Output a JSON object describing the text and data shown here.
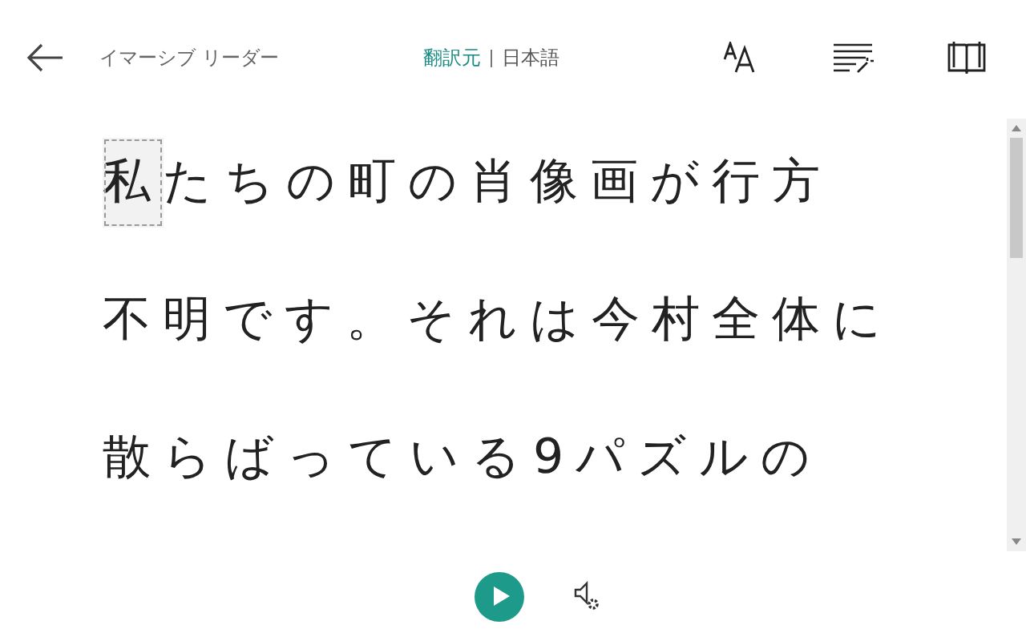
{
  "header": {
    "title": "イマーシブ リーダー",
    "source_label": "翻訳元",
    "language": "日本語"
  },
  "lines": [
    {
      "words": [
        {
          "text": "私",
          "selected": true
        },
        {
          "text": "たちの町の肖像画が行方",
          "selected": false
        }
      ]
    },
    {
      "words": [
        {
          "text": "不明です。それは今村全体に",
          "selected": false
        }
      ]
    },
    {
      "words": [
        {
          "text": "散らばっている9パズルの",
          "selected": false
        }
      ]
    }
  ]
}
